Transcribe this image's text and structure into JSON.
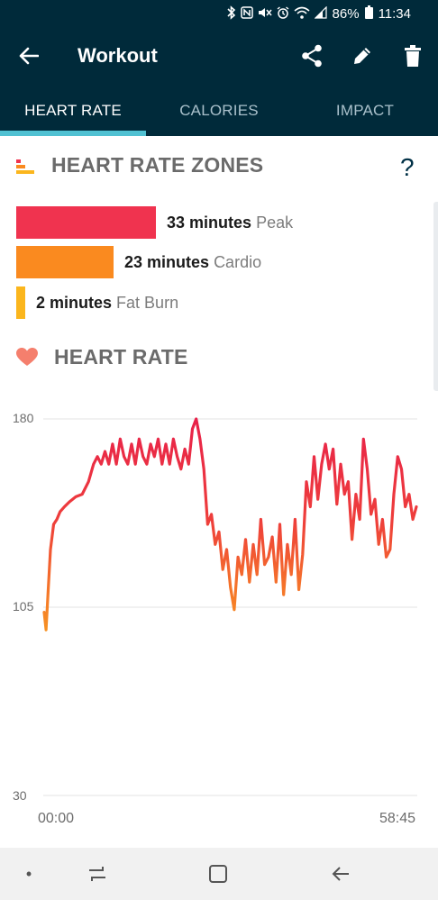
{
  "status": {
    "battery": "86%",
    "time": "11:34"
  },
  "appbar": {
    "title": "Workout"
  },
  "tabs": [
    {
      "label": "HEART RATE",
      "active": true
    },
    {
      "label": "CALORIES",
      "active": false
    },
    {
      "label": "IMPACT",
      "active": false
    }
  ],
  "zones": {
    "title": "HEART RATE ZONES",
    "help": "?",
    "items": [
      {
        "minutes": "33 minutes",
        "name": "Peak",
        "value": 33,
        "color": "#f0334f"
      },
      {
        "minutes": "23 minutes",
        "name": "Cardio",
        "value": 23,
        "color": "#fa8a1f"
      },
      {
        "minutes": "2 minutes",
        "name": "Fat Burn",
        "value": 2,
        "color": "#fbb61d"
      }
    ]
  },
  "heart_rate": {
    "title": "HEART RATE",
    "y_ticks": [
      "180",
      "105",
      "30"
    ],
    "x_ticks": [
      "00:00",
      "58:45"
    ]
  },
  "chart_data": {
    "type": "line",
    "title": "HEART RATE",
    "xlabel": "",
    "ylabel": "",
    "ylim": [
      30,
      180
    ],
    "xlim": [
      0,
      58.75
    ],
    "grid": true,
    "x": [
      0,
      0.3,
      0.6,
      1.0,
      1.5,
      2.0,
      2.5,
      3.2,
      4.0,
      5.0,
      6.0,
      7.0,
      7.8,
      8.4,
      9.0,
      9.6,
      10.2,
      10.8,
      11.4,
      12.0,
      12.6,
      13.2,
      13.8,
      14.4,
      15.0,
      15.6,
      16.2,
      16.8,
      17.4,
      18.0,
      18.6,
      19.2,
      19.8,
      20.4,
      21.0,
      21.6,
      22.2,
      22.8,
      23.4,
      24.0,
      24.6,
      25.2,
      25.8,
      26.4,
      27.0,
      27.6,
      28.2,
      28.8,
      29.4,
      30.0,
      30.6,
      31.2,
      31.8,
      32.4,
      33.0,
      33.6,
      34.2,
      34.8,
      35.4,
      36.0,
      36.6,
      37.2,
      37.8,
      38.4,
      39.0,
      39.6,
      40.2,
      40.8,
      41.4,
      42.0,
      42.6,
      43.2,
      43.8,
      44.4,
      45.0,
      45.6,
      46.2,
      46.8,
      47.4,
      48.0,
      48.6,
      49.2,
      49.8,
      50.4,
      51.0,
      51.6,
      52.2,
      52.8,
      53.4,
      54.0,
      54.6,
      55.2,
      55.8,
      56.4,
      57.0,
      57.6,
      58.2,
      58.75
    ],
    "series": [
      {
        "values": [
          103,
          96,
          110,
          128,
          138,
          140,
          143,
          145,
          147,
          149,
          150,
          155,
          162,
          165,
          162,
          167,
          162,
          170,
          162,
          172,
          165,
          162,
          170,
          162,
          172,
          165,
          162,
          170,
          165,
          172,
          162,
          170,
          162,
          172,
          165,
          160,
          168,
          162,
          176,
          180,
          172,
          160,
          138,
          142,
          130,
          135,
          120,
          128,
          113,
          104,
          125,
          118,
          132,
          115,
          130,
          118,
          140,
          122,
          125,
          133,
          115,
          138,
          110,
          130,
          118,
          140,
          112,
          126,
          155,
          145,
          165,
          148,
          162,
          170,
          160,
          168,
          146,
          162,
          150,
          155,
          132,
          150,
          140,
          172,
          160,
          142,
          148,
          130,
          140,
          125,
          128,
          150,
          165,
          160,
          145,
          150,
          140,
          145
        ]
      }
    ]
  },
  "nav": {
    "dot": "•"
  }
}
